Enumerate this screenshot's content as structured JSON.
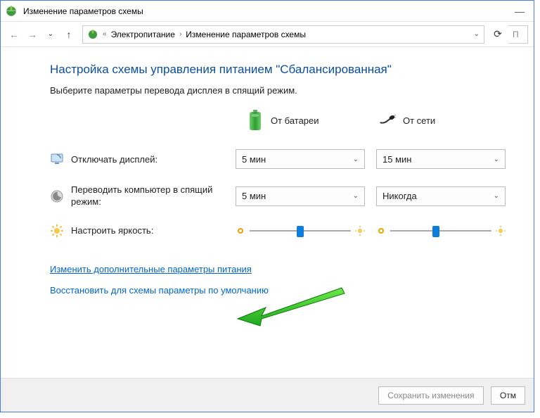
{
  "titlebar": {
    "title": "Изменение параметров схемы"
  },
  "breadcrumb": {
    "root": "Электропитание",
    "current": "Изменение параметров схемы"
  },
  "searchPlaceholder": "П",
  "heading": "Настройка схемы управления питанием \"Сбалансированная\"",
  "subtext": "Выберите параметры перевода дисплея в спящий режим.",
  "columns": {
    "battery": "От батареи",
    "plugged": "От сети"
  },
  "rows": {
    "display": {
      "label": "Отключать дисплей:",
      "battery": "5 мин",
      "plugged": "15 мин"
    },
    "sleep": {
      "label": "Переводить компьютер в спящий режим:",
      "battery": "5 мин",
      "plugged": "Никогда"
    },
    "bright": {
      "label": "Настроить яркость:"
    }
  },
  "brightness": {
    "battery": 50,
    "plugged": 45
  },
  "links": {
    "advanced": "Изменить дополнительные параметры питания",
    "restore": "Восстановить для схемы параметры по умолчанию"
  },
  "buttons": {
    "save": "Сохранить изменения",
    "cancel": "Отм"
  }
}
